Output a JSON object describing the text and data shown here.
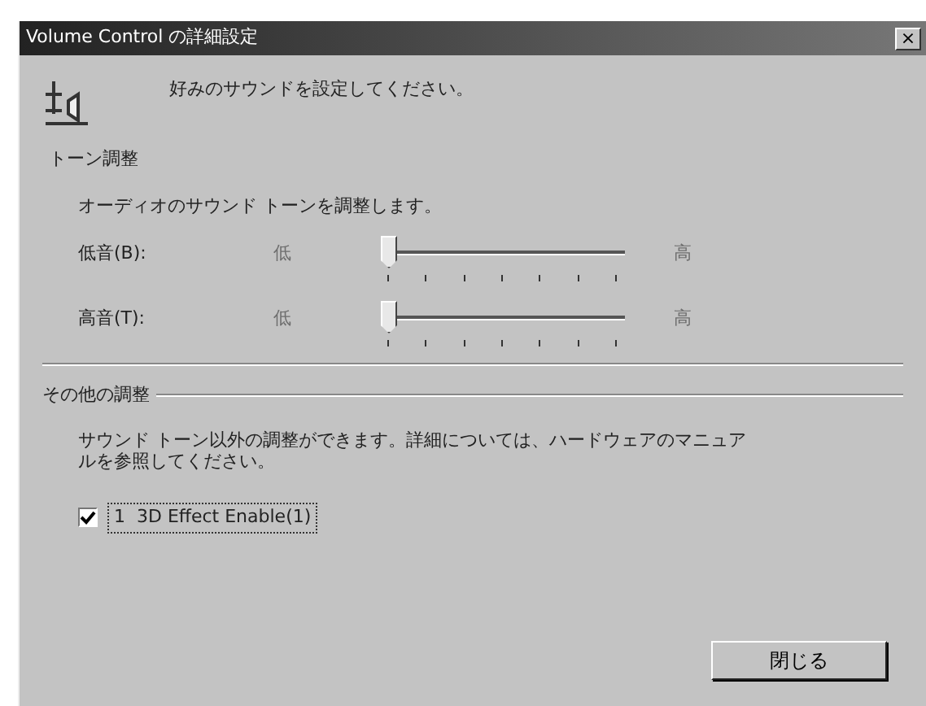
{
  "window": {
    "title": "Volume Control の詳細設定",
    "close": "×"
  },
  "intro": "好みのサウンドを設定してください。",
  "tone": {
    "heading": "トーン調整",
    "description": "オーディオのサウンド トーンを調整します。",
    "sliders": [
      {
        "label": "低音(B):",
        "min_label": "低",
        "max_label": "高",
        "level": 0
      },
      {
        "label": "高音(T):",
        "min_label": "低",
        "max_label": "高",
        "level": 0
      }
    ]
  },
  "other": {
    "heading": "その他の調整",
    "description": "サウンド トーン以外の調整ができます。詳細については、ハードウェアのマニュアルを参照してください。",
    "checkboxes": [
      {
        "label": "1  3D Effect Enable(1)",
        "checked": true
      }
    ]
  },
  "buttons": [
    "閉じる"
  ]
}
